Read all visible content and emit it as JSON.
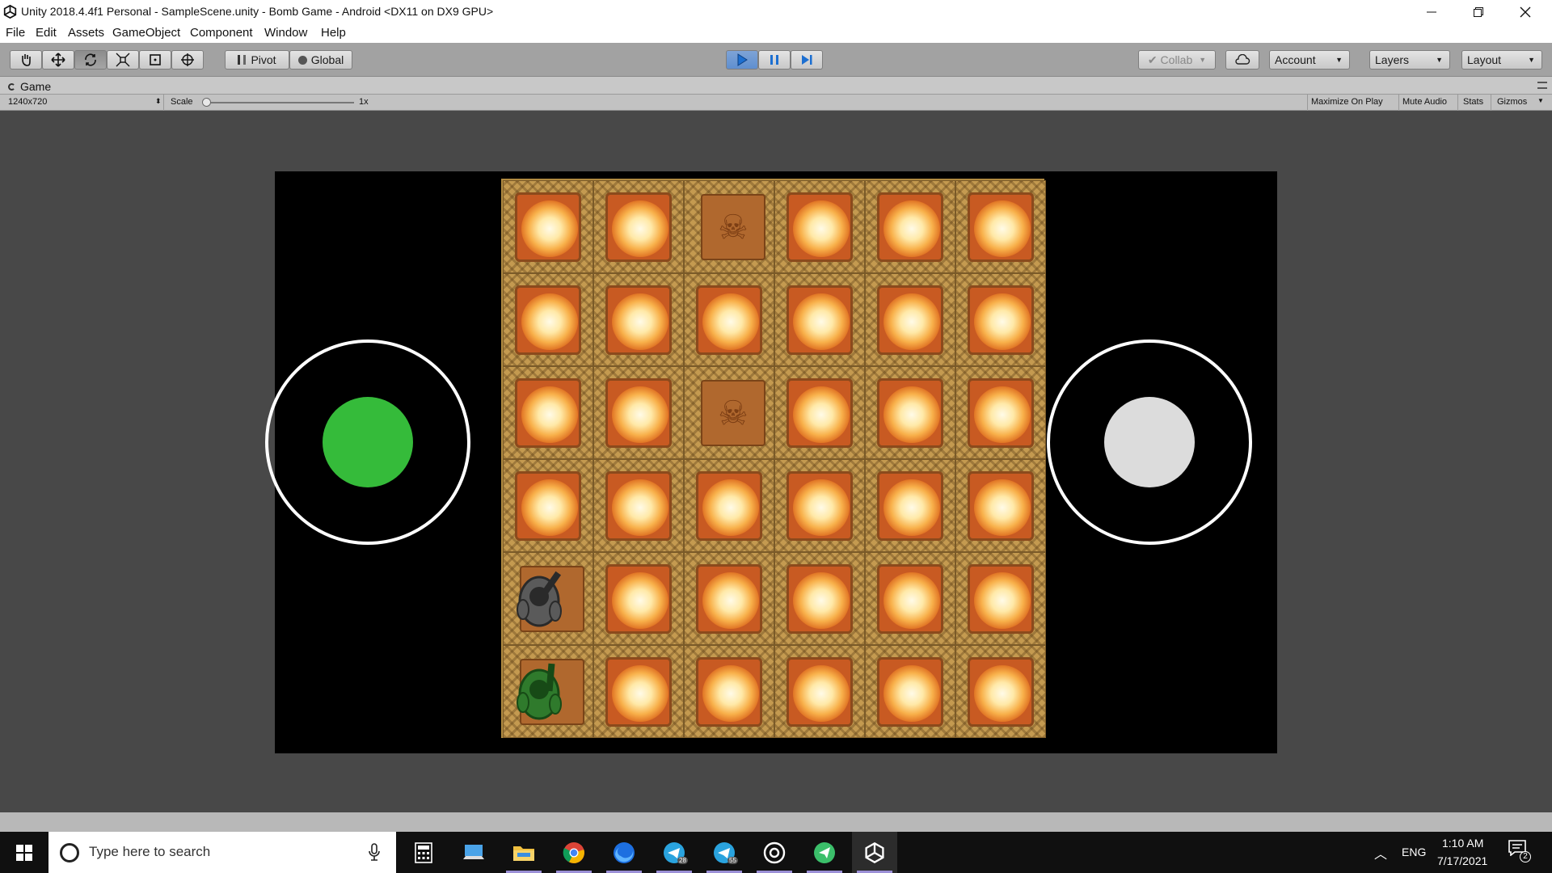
{
  "window": {
    "title": "Unity 2018.4.4f1 Personal - SampleScene.unity - Bomb Game - Android <DX11 on DX9 GPU>",
    "minimize_icon": "minimize-icon",
    "maximize_icon": "restore-icon",
    "close_icon": "close-icon"
  },
  "menu": [
    "File",
    "Edit",
    "Assets",
    "GameObject",
    "Component",
    "Window",
    "Help"
  ],
  "toolbar": {
    "tools": [
      "hand-icon",
      "move-icon",
      "rotate-icon",
      "scale-icon",
      "rect-icon",
      "transform-icon"
    ],
    "pivot_label": "Pivot",
    "global_label": "Global",
    "play_icon": "play-icon",
    "pause_icon": "pause-icon",
    "step_icon": "step-icon",
    "collab_label": "Collab",
    "cloud_icon": "cloud-icon",
    "account_label": "Account",
    "layers_label": "Layers",
    "layout_label": "Layout"
  },
  "game_panel": {
    "tab_label": "Game",
    "resolution": "1240x720",
    "scale_label": "Scale",
    "scale_value": "1x",
    "options": [
      "Maximize On Play",
      "Mute Audio",
      "Stats",
      "Gizmos"
    ]
  },
  "game": {
    "grid_rows": 6,
    "grid_cols": 6,
    "skull_tiles": [
      [
        0,
        2
      ],
      [
        2,
        2
      ]
    ],
    "player_gray_tile": [
      4,
      0
    ],
    "player_green_tile": [
      5,
      0
    ],
    "left_knob_color": "#35bb3a",
    "right_knob_color": "#dcdcdc"
  },
  "taskbar": {
    "search_placeholder": "Type here to search",
    "apps": [
      "calculator-icon",
      "pc-icon",
      "folder-icon",
      "chrome-icon",
      "firefox-icon",
      "telegram-icon",
      "telegram-icon",
      "obs-icon",
      "send-icon",
      "unity-icon"
    ],
    "badge_1": "28",
    "badge_2": "55",
    "language": "ENG",
    "time": "1:10 AM",
    "date": "7/17/2021",
    "notification_count": "2"
  }
}
